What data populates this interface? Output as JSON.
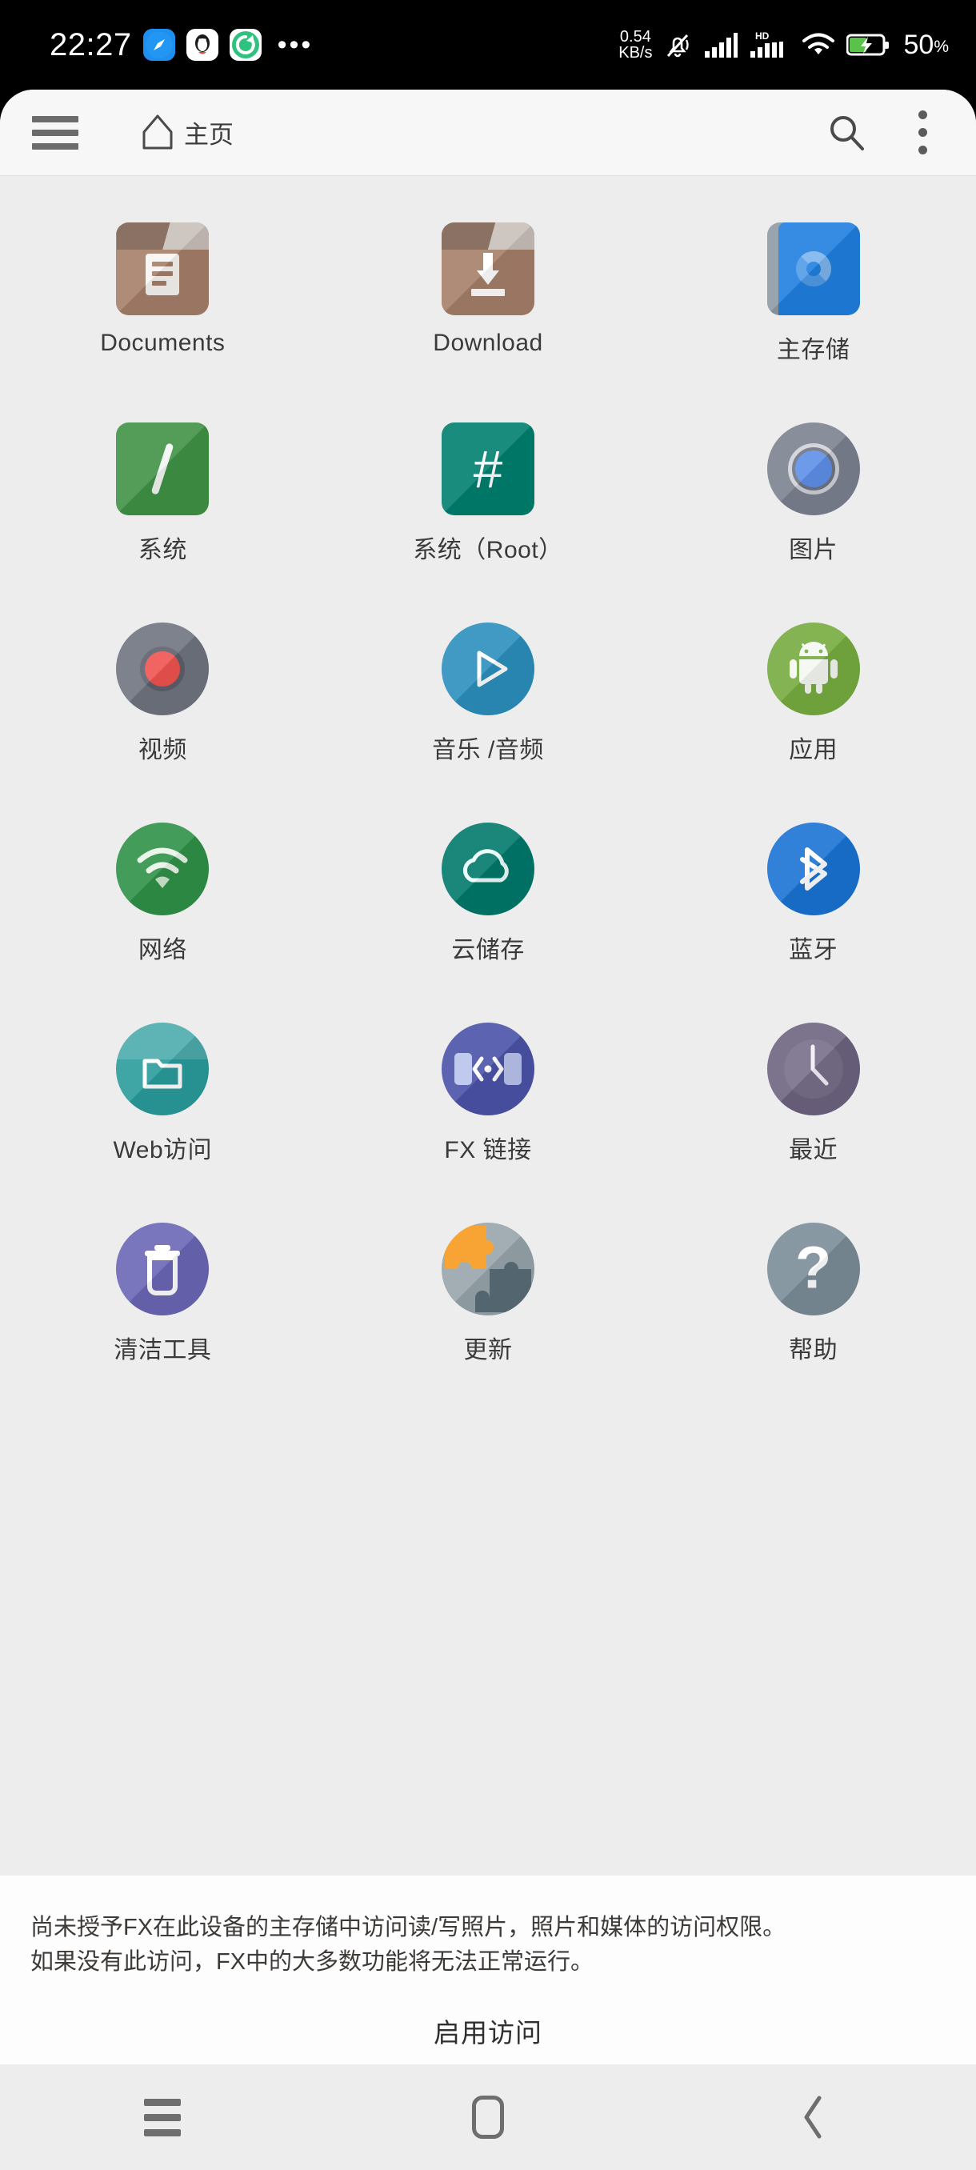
{
  "status_bar": {
    "time": "22:27",
    "app_icons": [
      "compass-browser-icon",
      "qq-penguin-icon",
      "sync-icon"
    ],
    "more_indicator": "•••",
    "network_speed_value": "0.54",
    "network_speed_unit": "KB/s",
    "icons": [
      "mute-bell-icon",
      "signal-bars-icon",
      "hd-icon",
      "signal-bars-2-icon",
      "wifi-icon",
      "battery-charging-icon"
    ],
    "hd_label": "HD",
    "battery_percent": "50",
    "battery_percent_symbol": "%"
  },
  "toolbar": {
    "menu_icon": "hamburger-menu-icon",
    "home_icon": "home-icon",
    "title": "主页",
    "search_icon": "search-icon",
    "overflow_icon": "overflow-menu-icon"
  },
  "grid": {
    "items": [
      {
        "label": "Documents",
        "icon": "documents-folder-icon",
        "color": "#a57f69"
      },
      {
        "label": "Download",
        "icon": "download-folder-icon",
        "color": "#a57f69"
      },
      {
        "label": "主存储",
        "icon": "main-storage-icon",
        "color": "#1f7fe0"
      },
      {
        "label": "系统",
        "icon": "system-root-slash-icon",
        "color": "#3f9245"
      },
      {
        "label": "系统（Root）",
        "icon": "system-root-hash-icon",
        "color": "#007f6e"
      },
      {
        "label": "图片",
        "icon": "pictures-icon",
        "color": "#7c8190"
      },
      {
        "label": "视频",
        "icon": "video-icon",
        "color": "#6f7480"
      },
      {
        "label": "音乐 /音频",
        "icon": "music-audio-icon",
        "color": "#2a8fbd"
      },
      {
        "label": "应用",
        "icon": "apps-android-icon",
        "color": "#76ac3f"
      },
      {
        "label": "网络",
        "icon": "network-wifi-icon",
        "color": "#2f9147"
      },
      {
        "label": "云储存",
        "icon": "cloud-storage-icon",
        "color": "#00796b"
      },
      {
        "label": "蓝牙",
        "icon": "bluetooth-icon",
        "color": "#1a73d4"
      },
      {
        "label": "Web访问",
        "icon": "web-access-icon",
        "color": "#2a9b9b"
      },
      {
        "label": "FX 链接",
        "icon": "fx-connect-icon",
        "color": "#4a53a8"
      },
      {
        "label": "最近",
        "icon": "recent-clock-icon",
        "color": "#6d6380"
      },
      {
        "label": "清洁工具",
        "icon": "clean-tools-trash-icon",
        "color": "#6a66b5"
      },
      {
        "label": "更新",
        "icon": "update-puzzle-icon",
        "color": "#f79a1e"
      },
      {
        "label": "帮助",
        "icon": "help-question-icon",
        "color": "#7b8d99"
      }
    ]
  },
  "permission_banner": {
    "line1": "尚未授予FX在此设备的主存储中访问读/写照片，照片和媒体的访问权限。",
    "line2": "如果没有此访问，FX中的大多数功能将无法正常运行。",
    "action_label": "启用访问"
  },
  "nav_bar": {
    "recents_icon": "recents-icon",
    "home_icon": "home-square-icon",
    "back_icon": "back-chevron-icon"
  }
}
